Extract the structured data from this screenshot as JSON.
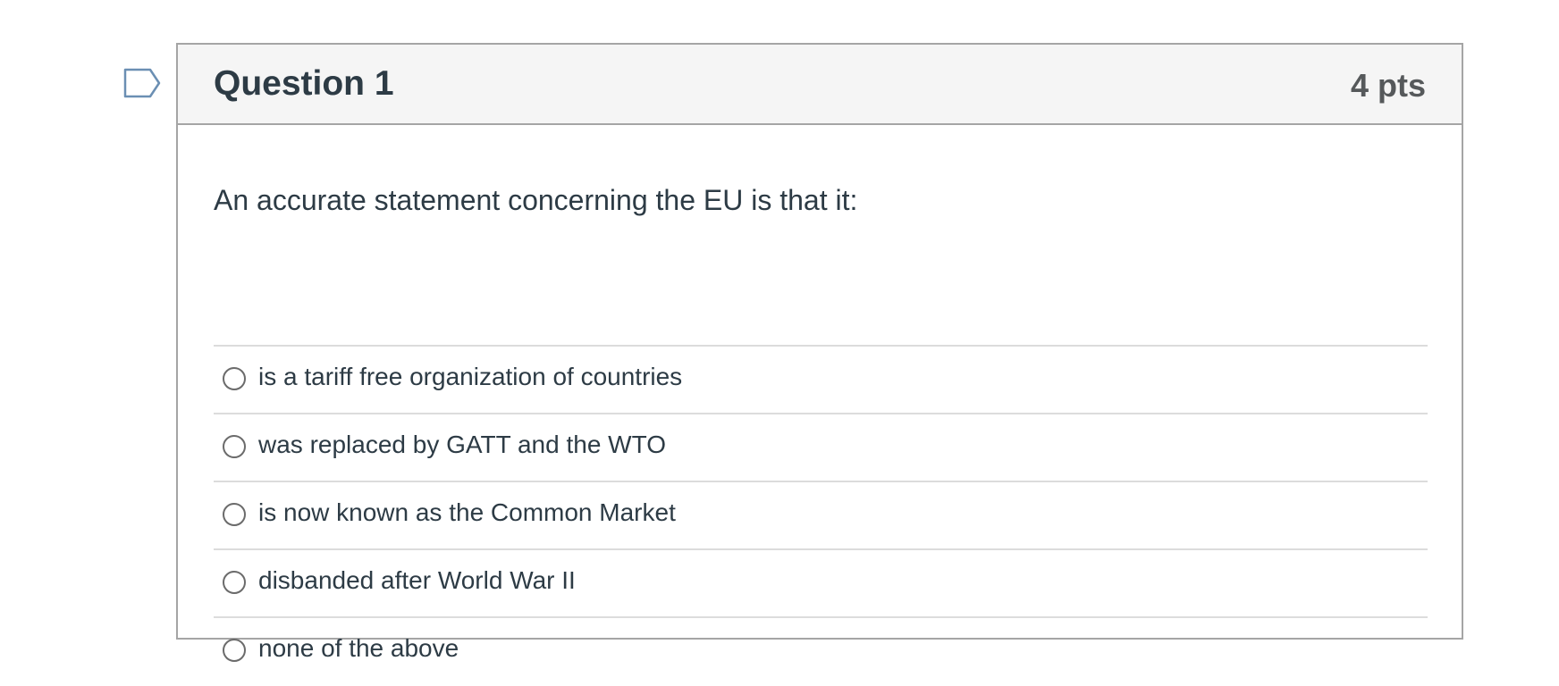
{
  "question": {
    "title": "Question 1",
    "points": "4 pts",
    "text": "An accurate statement concerning the EU is that it:",
    "answers": [
      "is a tariff free organization of countries",
      "was replaced by GATT and the WTO",
      "is now known as the Common Market",
      "disbanded after World War II",
      "none of the above"
    ]
  },
  "colors": {
    "header_bg": "#f5f5f5",
    "border": "#a5a5a5",
    "text": "#2d3b45",
    "flag": "#6b8fb3"
  },
  "icons": {
    "flag": "flag-question-icon",
    "radio": "radio-unchecked-icon"
  }
}
